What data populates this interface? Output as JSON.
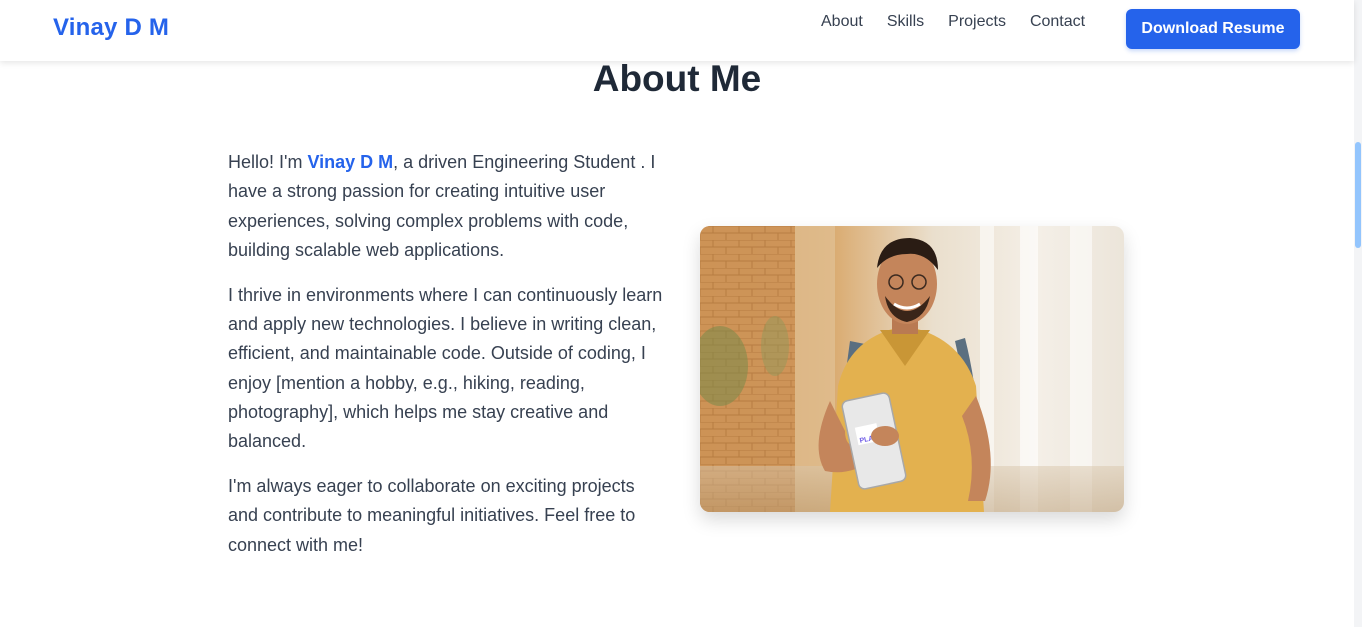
{
  "nav": {
    "brand": "Vinay D M",
    "links": [
      "About",
      "Skills",
      "Projects",
      "Contact"
    ],
    "resume_button": "Download Resume"
  },
  "about": {
    "title": "About Me",
    "p1_prefix": "Hello! I'm ",
    "p1_name": "Vinay D M",
    "p1_rest": ", a driven Engineering Student . I have a strong passion for creating intuitive user experiences, solving complex problems with code, building scalable web applications.",
    "p2": "I thrive in environments where I can continuously learn and apply new technologies. I believe in writing clean, efficient, and maintainable code. Outside of coding, I enjoy [mention a hobby, e.g., hiking, reading, photography], which helps me stay creative and balanced.",
    "p3": "I'm always eager to collaborate on exciting projects and contribute to meaningful initiatives. Feel free to connect with me!"
  },
  "photo": {
    "book_text": "PLAY"
  },
  "colors": {
    "accent": "#2563eb",
    "text": "#374151",
    "heading": "#1f2937"
  }
}
